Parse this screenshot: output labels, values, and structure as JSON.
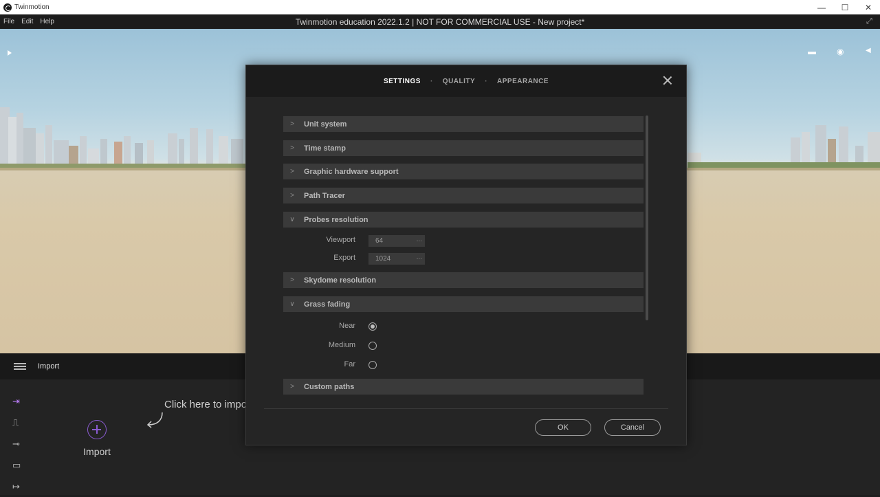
{
  "os_window": {
    "app_name": "Twinmotion",
    "controls": [
      "—",
      "☐",
      "✕"
    ]
  },
  "menubar": {
    "items": [
      "File",
      "Edit",
      "Help"
    ],
    "window_title": "Twinmotion education 2022.1.2 | NOT FOR COMMERCIAL USE - New project*"
  },
  "bottom_panel": {
    "title": "Import",
    "import_tile_label": "Import",
    "hint": "Click here to impo",
    "active_color": "#b97cf5"
  },
  "dialog": {
    "tabs": [
      {
        "label": "SETTINGS",
        "active": true
      },
      {
        "label": "QUALITY",
        "active": false
      },
      {
        "label": "APPEARANCE",
        "active": false
      }
    ],
    "separator": "·",
    "sections": {
      "unit_system": {
        "label": "Unit system",
        "expanded": false
      },
      "time_stamp": {
        "label": "Time stamp",
        "expanded": false
      },
      "graphic_hardware": {
        "label": "Graphic hardware support",
        "expanded": false
      },
      "path_tracer": {
        "label": "Path Tracer",
        "expanded": false
      },
      "probes_resolution": {
        "label": "Probes resolution",
        "expanded": true
      },
      "skydome_resolution": {
        "label": "Skydome resolution",
        "expanded": false
      },
      "grass_fading": {
        "label": "Grass fading",
        "expanded": true
      },
      "custom_paths": {
        "label": "Custom paths",
        "expanded": false
      }
    },
    "chevron_collapsed": ">",
    "chevron_expanded": "∨",
    "probes": {
      "viewport_label": "Viewport",
      "viewport_value": "64",
      "export_label": "Export",
      "export_value": "1024",
      "dots": "..."
    },
    "grass": {
      "near_label": "Near",
      "medium_label": "Medium",
      "far_label": "Far",
      "selected": "Near"
    },
    "ok_label": "OK",
    "cancel_label": "Cancel"
  }
}
